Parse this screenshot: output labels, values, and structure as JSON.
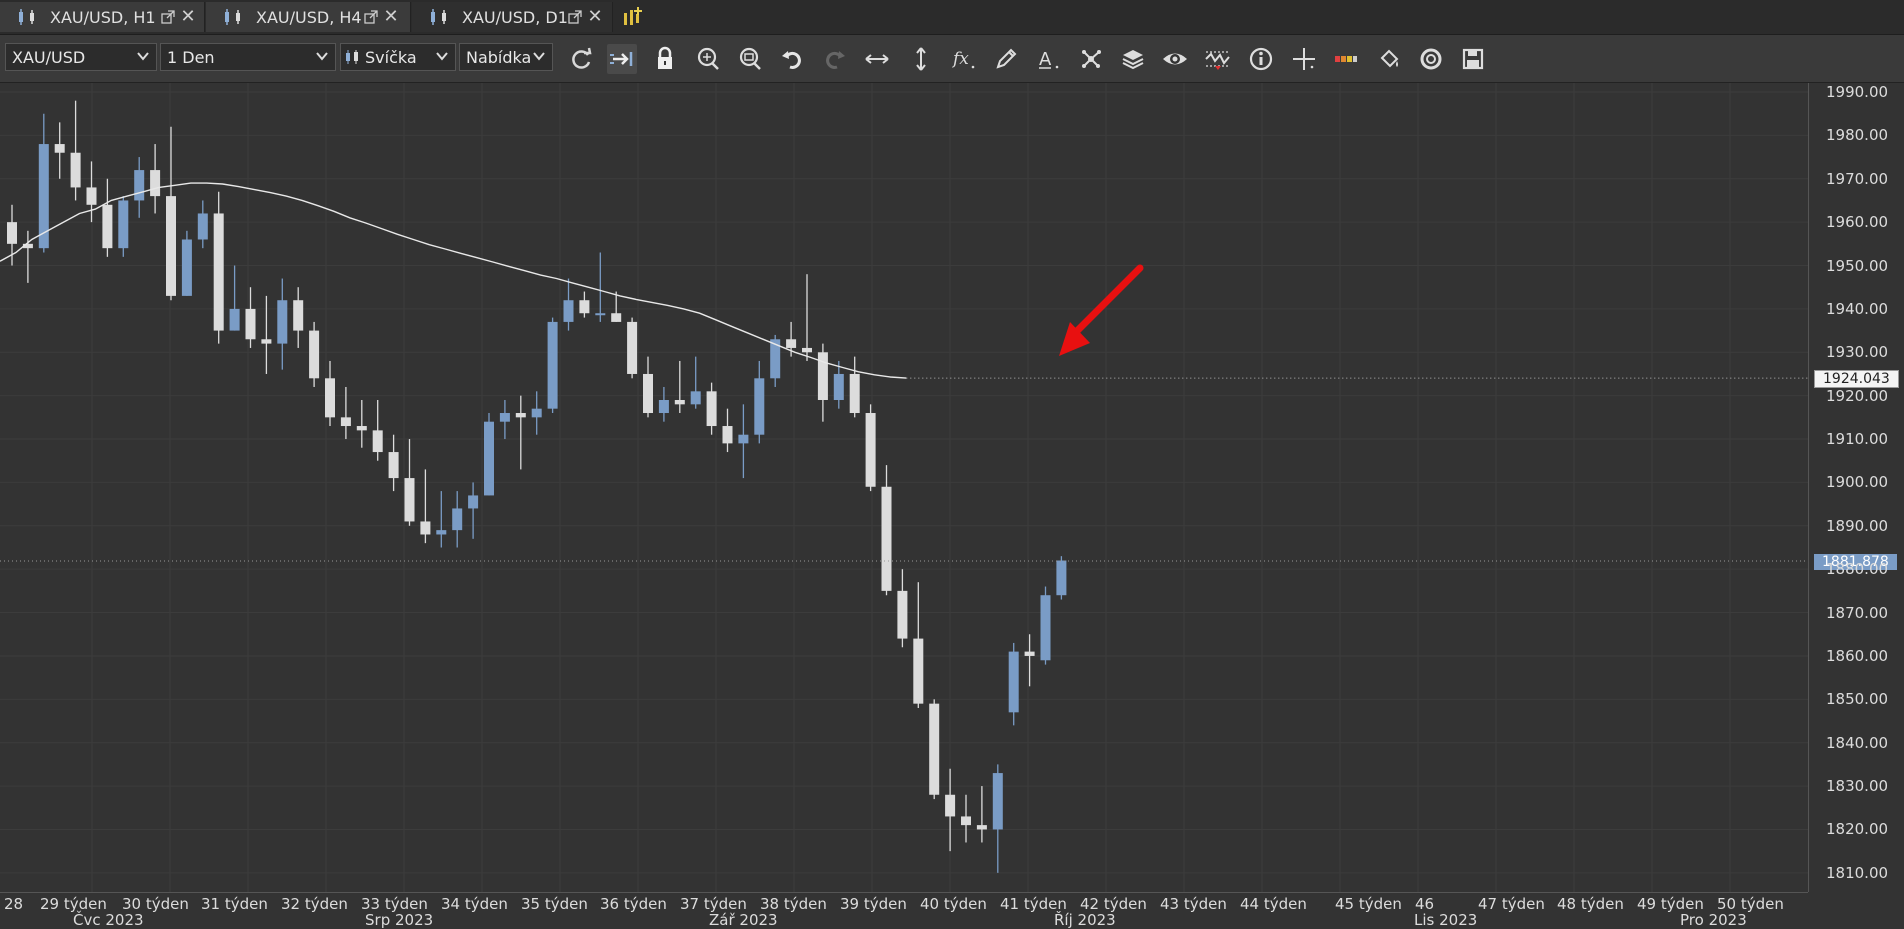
{
  "tabs": [
    {
      "label": "XAU/USD, H1",
      "active": false
    },
    {
      "label": "XAU/USD, H4",
      "active": false
    },
    {
      "label": "XAU/USD, D1",
      "active": true
    }
  ],
  "toolbar": {
    "instrument": "XAU/USD",
    "period": "1 Den",
    "chart_type": "Svíčka",
    "price_side": "Nabídka",
    "buttons": [
      "refresh-icon",
      "shift-icon",
      "lock-icon",
      "zoom-in-icon",
      "zoom-out-icon",
      "undo-icon",
      "redo-icon",
      "horizontal-scale-icon",
      "vertical-scale-icon",
      "fx-indicators-icon",
      "pencil-icon",
      "text-icon",
      "pattern-icon",
      "layers-icon",
      "eye-icon",
      "oscillator-icon",
      "info-icon",
      "crosshair-icon",
      "color-bars-icon",
      "paint-bucket-icon",
      "target-icon",
      "save-icon"
    ]
  },
  "chart_data": {
    "type": "candlestick",
    "instrument": "XAU/USD",
    "timeframe": "1 Den",
    "ylim": [
      1806,
      1993
    ],
    "price_ticks": [
      "1990.00",
      "1980.00",
      "1970.00",
      "1960.00",
      "1950.00",
      "1940.00",
      "1930.00",
      "1920.00",
      "1910.00",
      "1900.00",
      "1890.00",
      "1880.00",
      "1870.00",
      "1860.00",
      "1850.00",
      "1840.00",
      "1830.00",
      "1820.00",
      "1810.00"
    ],
    "week_labels": [
      "28",
      "29 týden",
      "30 týden",
      "31 týden",
      "32 týden",
      "33 týden",
      "34 týden",
      "35 týden",
      "36 týden",
      "37 týden",
      "38 týden",
      "39 týden",
      "40 týden",
      "41 týden",
      "42 týden",
      "43 týden",
      "44 týden",
      "45 týden",
      "46",
      "47 týden",
      "48 týden",
      "49 týden",
      "50 týden"
    ],
    "month_labels": [
      "Čvc 2023",
      "Srp 2023",
      "Zář 2023",
      "Říj 2023",
      "Lis 2023",
      "Pro 2023"
    ],
    "ma_label": "1924.043",
    "ma_value": 1924.043,
    "last_price_label": "1881.878",
    "last_price": 1881.878,
    "colors": {
      "bull": "#7a9cc6",
      "bear": "#dcdcdc",
      "background": "#333333",
      "ma_line": "#e8e8e8",
      "arrow": "#e81010"
    },
    "candles": [
      {
        "o": 1960,
        "h": 1964,
        "l": 1950,
        "c": 1955
      },
      {
        "o": 1955,
        "h": 1958,
        "l": 1946,
        "c": 1954
      },
      {
        "o": 1954,
        "h": 1985,
        "l": 1953,
        "c": 1978
      },
      {
        "o": 1978,
        "h": 1983,
        "l": 1970,
        "c": 1976
      },
      {
        "o": 1976,
        "h": 1988,
        "l": 1965,
        "c": 1968
      },
      {
        "o": 1968,
        "h": 1974,
        "l": 1960,
        "c": 1964
      },
      {
        "o": 1964,
        "h": 1970,
        "l": 1952,
        "c": 1954
      },
      {
        "o": 1954,
        "h": 1966,
        "l": 1952,
        "c": 1965
      },
      {
        "o": 1965,
        "h": 1975,
        "l": 1961,
        "c": 1972
      },
      {
        "o": 1972,
        "h": 1978,
        "l": 1962,
        "c": 1966
      },
      {
        "o": 1966,
        "h": 1982,
        "l": 1942,
        "c": 1943
      },
      {
        "o": 1943,
        "h": 1958,
        "l": 1943,
        "c": 1956
      },
      {
        "o": 1956,
        "h": 1965,
        "l": 1954,
        "c": 1962
      },
      {
        "o": 1962,
        "h": 1967,
        "l": 1932,
        "c": 1935
      },
      {
        "o": 1935,
        "h": 1950,
        "l": 1935,
        "c": 1940
      },
      {
        "o": 1940,
        "h": 1945,
        "l": 1931,
        "c": 1933
      },
      {
        "o": 1933,
        "h": 1943,
        "l": 1925,
        "c": 1932
      },
      {
        "o": 1932,
        "h": 1947,
        "l": 1926,
        "c": 1942
      },
      {
        "o": 1942,
        "h": 1945,
        "l": 1931,
        "c": 1935
      },
      {
        "o": 1935,
        "h": 1937,
        "l": 1922,
        "c": 1924
      },
      {
        "o": 1924,
        "h": 1928,
        "l": 1913,
        "c": 1915
      },
      {
        "o": 1915,
        "h": 1922,
        "l": 1910,
        "c": 1913
      },
      {
        "o": 1913,
        "h": 1919,
        "l": 1908,
        "c": 1912
      },
      {
        "o": 1912,
        "h": 1919,
        "l": 1905,
        "c": 1907
      },
      {
        "o": 1907,
        "h": 1911,
        "l": 1898,
        "c": 1901
      },
      {
        "o": 1901,
        "h": 1910,
        "l": 1890,
        "c": 1891
      },
      {
        "o": 1891,
        "h": 1903,
        "l": 1886,
        "c": 1888
      },
      {
        "o": 1888,
        "h": 1898,
        "l": 1885,
        "c": 1889
      },
      {
        "o": 1889,
        "h": 1898,
        "l": 1885,
        "c": 1894
      },
      {
        "o": 1894,
        "h": 1900,
        "l": 1887,
        "c": 1897
      },
      {
        "o": 1897,
        "h": 1916,
        "l": 1897,
        "c": 1914
      },
      {
        "o": 1914,
        "h": 1919,
        "l": 1910,
        "c": 1916
      },
      {
        "o": 1916,
        "h": 1920,
        "l": 1903,
        "c": 1915
      },
      {
        "o": 1915,
        "h": 1921,
        "l": 1911,
        "c": 1917
      },
      {
        "o": 1917,
        "h": 1938,
        "l": 1916,
        "c": 1937
      },
      {
        "o": 1937,
        "h": 1947,
        "l": 1935,
        "c": 1942
      },
      {
        "o": 1942,
        "h": 1944,
        "l": 1938,
        "c": 1939
      },
      {
        "o": 1939,
        "h": 1953,
        "l": 1937,
        "c": 1939
      },
      {
        "o": 1939,
        "h": 1944,
        "l": 1937,
        "c": 1937
      },
      {
        "o": 1937,
        "h": 1938,
        "l": 1924,
        "c": 1925
      },
      {
        "o": 1925,
        "h": 1929,
        "l": 1915,
        "c": 1916
      },
      {
        "o": 1916,
        "h": 1922,
        "l": 1914,
        "c": 1919
      },
      {
        "o": 1919,
        "h": 1928,
        "l": 1916,
        "c": 1918
      },
      {
        "o": 1918,
        "h": 1929,
        "l": 1917,
        "c": 1921
      },
      {
        "o": 1921,
        "h": 1923,
        "l": 1911,
        "c": 1913
      },
      {
        "o": 1913,
        "h": 1917,
        "l": 1907,
        "c": 1909
      },
      {
        "o": 1909,
        "h": 1918,
        "l": 1901,
        "c": 1911
      },
      {
        "o": 1911,
        "h": 1928,
        "l": 1909,
        "c": 1924
      },
      {
        "o": 1924,
        "h": 1934,
        "l": 1922,
        "c": 1933
      },
      {
        "o": 1933,
        "h": 1937,
        "l": 1929,
        "c": 1931
      },
      {
        "o": 1931,
        "h": 1948,
        "l": 1928,
        "c": 1930
      },
      {
        "o": 1930,
        "h": 1932,
        "l": 1914,
        "c": 1919
      },
      {
        "o": 1919,
        "h": 1928,
        "l": 1917,
        "c": 1925
      },
      {
        "o": 1925,
        "h": 1929,
        "l": 1915,
        "c": 1916
      },
      {
        "o": 1916,
        "h": 1918,
        "l": 1898,
        "c": 1899
      },
      {
        "o": 1899,
        "h": 1904,
        "l": 1874,
        "c": 1875
      },
      {
        "o": 1875,
        "h": 1880,
        "l": 1862,
        "c": 1864
      },
      {
        "o": 1864,
        "h": 1877,
        "l": 1848,
        "c": 1849
      },
      {
        "o": 1849,
        "h": 1850,
        "l": 1827,
        "c": 1828
      },
      {
        "o": 1828,
        "h": 1834,
        "l": 1815,
        "c": 1823
      },
      {
        "o": 1823,
        "h": 1828,
        "l": 1817,
        "c": 1821
      },
      {
        "o": 1821,
        "h": 1830,
        "l": 1817,
        "c": 1820
      },
      {
        "o": 1820,
        "h": 1835,
        "l": 1810,
        "c": 1833
      },
      {
        "o": 1847,
        "h": 1863,
        "l": 1844,
        "c": 1861
      },
      {
        "o": 1861,
        "h": 1865,
        "l": 1853,
        "c": 1860
      },
      {
        "o": 1859,
        "h": 1876,
        "l": 1858,
        "c": 1874
      },
      {
        "o": 1874,
        "h": 1883,
        "l": 1873,
        "c": 1882
      }
    ],
    "ma_line": [
      1951,
      1953,
      1956,
      1958,
      1960,
      1962,
      1963,
      1965,
      1966,
      1967,
      1968,
      1968.5,
      1969,
      1969,
      1968.8,
      1968.2,
      1967.5,
      1966.8,
      1966,
      1965,
      1963.8,
      1962.5,
      1961,
      1959.8,
      1958.5,
      1957.2,
      1956,
      1954.8,
      1953.8,
      1952.8,
      1951.8,
      1950.8,
      1949.8,
      1948.8,
      1947.8,
      1947,
      1946,
      1945,
      1944,
      1943,
      1942.2,
      1941.5,
      1940.8,
      1940,
      1939,
      1937.5,
      1936,
      1934.5,
      1933,
      1931.5,
      1930,
      1928.8,
      1927.5,
      1926.5,
      1925.5,
      1924.8,
      1924.3,
      1924.043
    ]
  }
}
